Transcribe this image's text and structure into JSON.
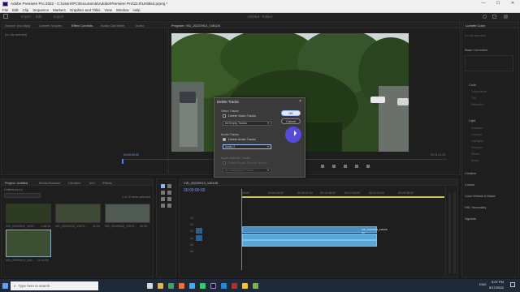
{
  "titlebar": {
    "title": "Adobe Premiere Pro 2022 - C:\\Users\\PC\\Documents\\Adobe\\Premiere Pro\\22.0\\Untitled.prproj *",
    "minimize": "—",
    "maximize": "☐",
    "close": "✕"
  },
  "menu": {
    "items": [
      "File",
      "Edit",
      "Clip",
      "Sequence",
      "Markers",
      "Graphics and Titles",
      "View",
      "Window",
      "Help"
    ]
  },
  "workspaces": {
    "left_tabs": [
      "Import",
      "Edit",
      "Export"
    ],
    "center": "Untitled - Edited"
  },
  "source_panel": {
    "tabs": [
      "Source: (no clips)",
      "Lumetri Scopes",
      "Effect Controls",
      "Audio Clip Mixer",
      "Audio"
    ],
    "content": "(no clip selected)"
  },
  "program_panel": {
    "title": "Program: VID_20220913_145126",
    "timecode_left": "00:00:00:00",
    "fit": "Fit",
    "timecode_right": "00:11:11:29",
    "quality": "Full"
  },
  "project_panel": {
    "tabs": [
      "Project: Untitled",
      "Media Browser",
      "Libraries",
      "Info",
      "Effects"
    ],
    "project_file": "Untitled.prproj",
    "count": "1 of 10 items selected",
    "items": [
      {
        "name": "VID_20220912_1125...",
        "duration": "1:48:18"
      },
      {
        "name": "VID_20220912_13570...",
        "duration": "11:20"
      },
      {
        "name": "VID_20220912_13570...",
        "duration": "20:26"
      },
      {
        "name": "VID_20220913_145...",
        "duration": "11:11:29"
      }
    ]
  },
  "timeline": {
    "tab": "VID_20220913_145126",
    "timecode": "00:00:00:00",
    "ruler": [
      "00:00",
      "00:04:16:00",
      "00:08:32:00",
      "00:12:48:00",
      "00:17:04:00",
      "00:21:20:00",
      "00:25:36:00"
    ],
    "tracks": [
      "V3",
      "V2",
      "V1",
      "A1",
      "A2",
      "A3"
    ],
    "clip_label": "VID_20220913_145126 [V]"
  },
  "right_panel": {
    "tab": "Lumetri Color",
    "no_clip": "(no clip selected)",
    "sections": [
      "Basic Correction",
      "Color",
      "Light",
      "Creative",
      "Curves",
      "Color Wheels & Match",
      "HSL Secondary",
      "Vignette"
    ],
    "color_rows": [
      "Temperature",
      "Tint",
      "Saturation"
    ],
    "light_rows": [
      "Exposure",
      "Contrast",
      "Highlights",
      "Shadows",
      "Whites",
      "Blacks"
    ]
  },
  "dialog": {
    "title": "Delete Tracks",
    "ok": "OK",
    "cancel": "Cancel",
    "video_group": "Video Tracks",
    "delete_video": "Delete Video Tracks",
    "video_select": "All Empty Tracks",
    "audio_group": "Audio Tracks",
    "delete_audio": "Delete Audio Tracks",
    "audio_select": "Audio 2",
    "submix_group": "Audio Submix Tracks",
    "delete_submix": "Delete Audio Submix Tracks",
    "submix_select": "All Unassigned Tracks"
  },
  "taskbar": {
    "search_placeholder": "Type here to search",
    "time": "5:07 PM",
    "date": "9/17/2022",
    "lang": "ENG"
  },
  "colors": {
    "accent_blue": "#4a8fc4",
    "playhead": "#3e8bff",
    "cursor": "#5a4cf0"
  }
}
